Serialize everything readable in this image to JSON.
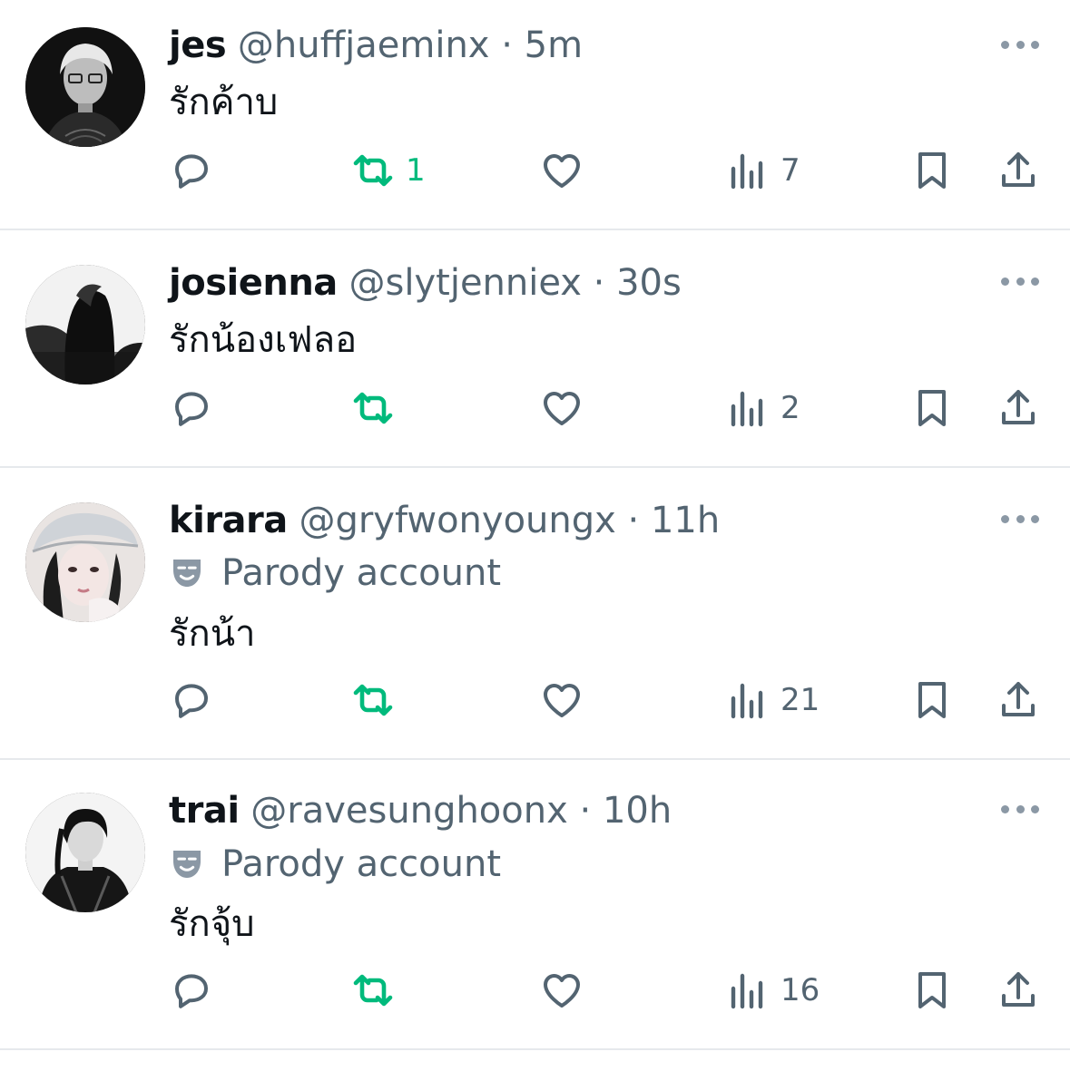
{
  "colors": {
    "retweet_active": "#00ba7c",
    "secondary_text": "#536471",
    "divider": "#e6e9ec"
  },
  "icons": {
    "reply": "speech-bubble-icon",
    "retweet": "retweet-arrows-icon",
    "like": "heart-icon",
    "views": "bar-chart-icon",
    "bookmark": "bookmark-icon",
    "share": "share-upload-icon",
    "more": "ellipsis-icon",
    "parody": "theater-mask-icon"
  },
  "tweets": [
    {
      "name": "jes",
      "handle": "@huffjaeminx",
      "separator": "·",
      "time": "5m",
      "parody_label": "",
      "text": "รักค้าบ",
      "retweets": "1",
      "views": "7"
    },
    {
      "name": "josienna",
      "handle": "@slytjenniex",
      "separator": "·",
      "time": "30s",
      "parody_label": "",
      "text": "รักน้องเฟลอ",
      "retweets": "",
      "views": "2"
    },
    {
      "name": "kirara",
      "handle": "@gryfwonyoungx",
      "separator": "·",
      "time": "11h",
      "parody_label": "Parody account",
      "text": "รักน้า",
      "retweets": "",
      "views": "21"
    },
    {
      "name": "trai",
      "handle": "@ravesunghoonx",
      "separator": "·",
      "time": "10h",
      "parody_label": "Parody account",
      "text": "รักจุ้บ",
      "retweets": "",
      "views": "16"
    }
  ]
}
